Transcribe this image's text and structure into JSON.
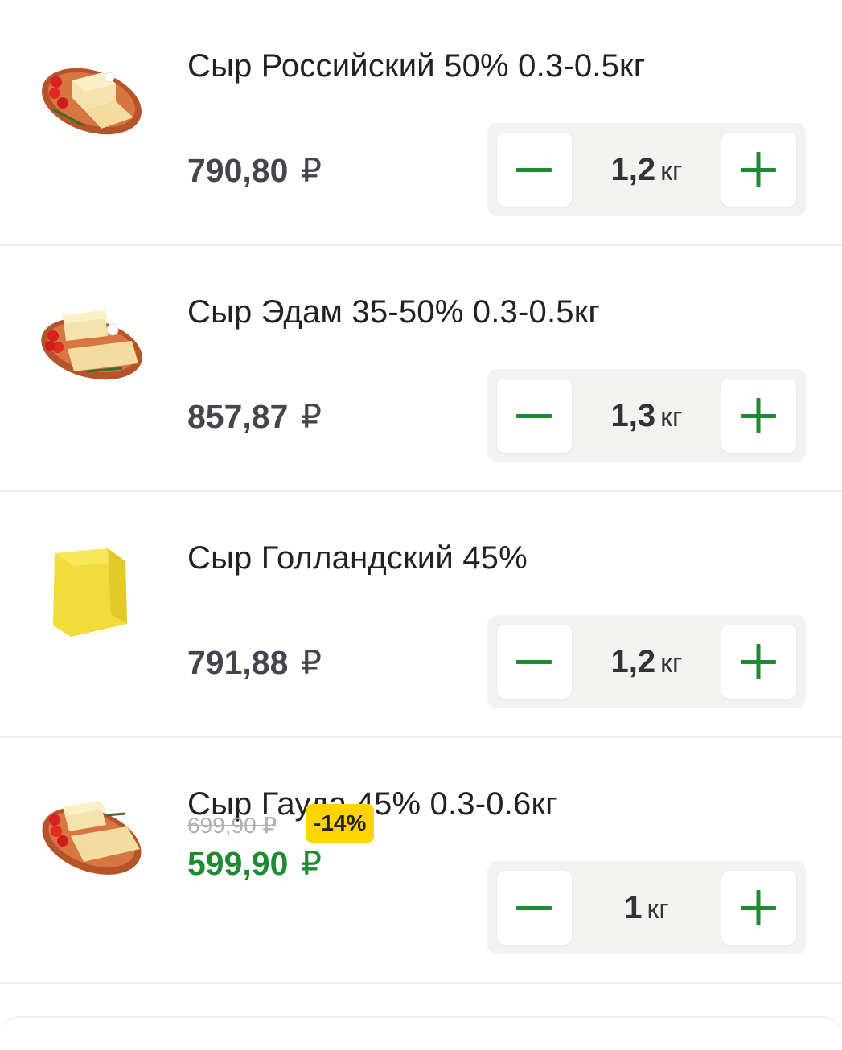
{
  "products": [
    {
      "name": "Сыр Российский 50% 0.3-0.5кг",
      "image_icon": "cheese-platter-icon",
      "price": "790,80",
      "currency": "₽",
      "quantity": "1,2",
      "unit": "кг"
    },
    {
      "name": "Сыр Эдам 35-50% 0.3-0.5кг",
      "image_icon": "cheese-platter-icon",
      "price": "857,87",
      "currency": "₽",
      "quantity": "1,3",
      "unit": "кг"
    },
    {
      "name": "Сыр Голландский 45%",
      "image_icon": "cheese-block-icon",
      "price": "791,88",
      "currency": "₽",
      "quantity": "1,2",
      "unit": "кг"
    },
    {
      "name": "Сыр Гауда 45% 0.3-0.6кг",
      "image_icon": "cheese-platter-icon",
      "old_price": "699,90 ₽",
      "discount": "-14%",
      "price": "599,90",
      "currency": "₽",
      "quantity": "1",
      "unit": "кг"
    }
  ],
  "colors": {
    "accent_green": "#1e8a32",
    "discount_badge": "#ffd400",
    "price_gray": "#45454f",
    "stepper_bg": "#f2f2f0"
  },
  "icons": {
    "decrease": "minus-icon",
    "increase": "plus-icon"
  }
}
